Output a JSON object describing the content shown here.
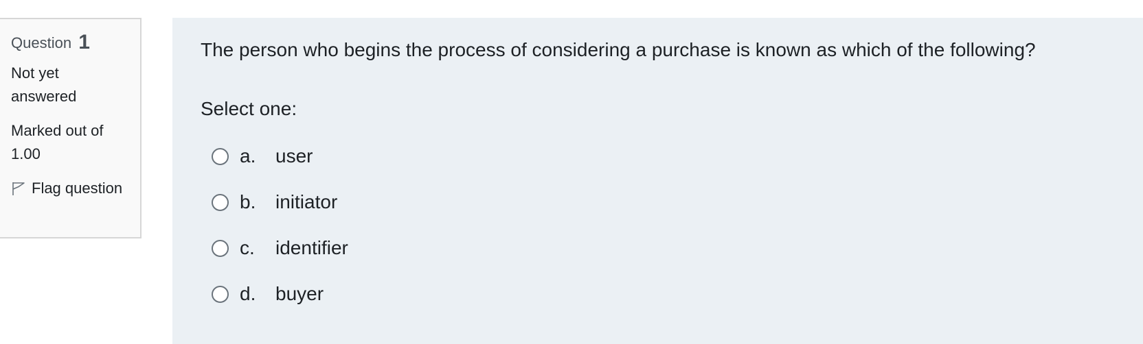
{
  "info": {
    "question_label": "Question",
    "question_number": "1",
    "state": "Not yet answered",
    "grade": "Marked out of 1.00",
    "flag_label": "Flag question",
    "flag_icon": "flag-icon"
  },
  "question": {
    "text": "The person who begins the process of considering a purchase is known as which of the following?",
    "prompt": "Select one:",
    "options": [
      {
        "letter": "a.",
        "text": "user"
      },
      {
        "letter": "b.",
        "text": "initiator"
      },
      {
        "letter": "c.",
        "text": "identifier"
      },
      {
        "letter": "d.",
        "text": "buyer"
      }
    ]
  },
  "colors": {
    "content_background": "#ebf0f4",
    "info_background": "#f9f9f9",
    "text": "#1d2125",
    "muted_text": "#495057"
  }
}
